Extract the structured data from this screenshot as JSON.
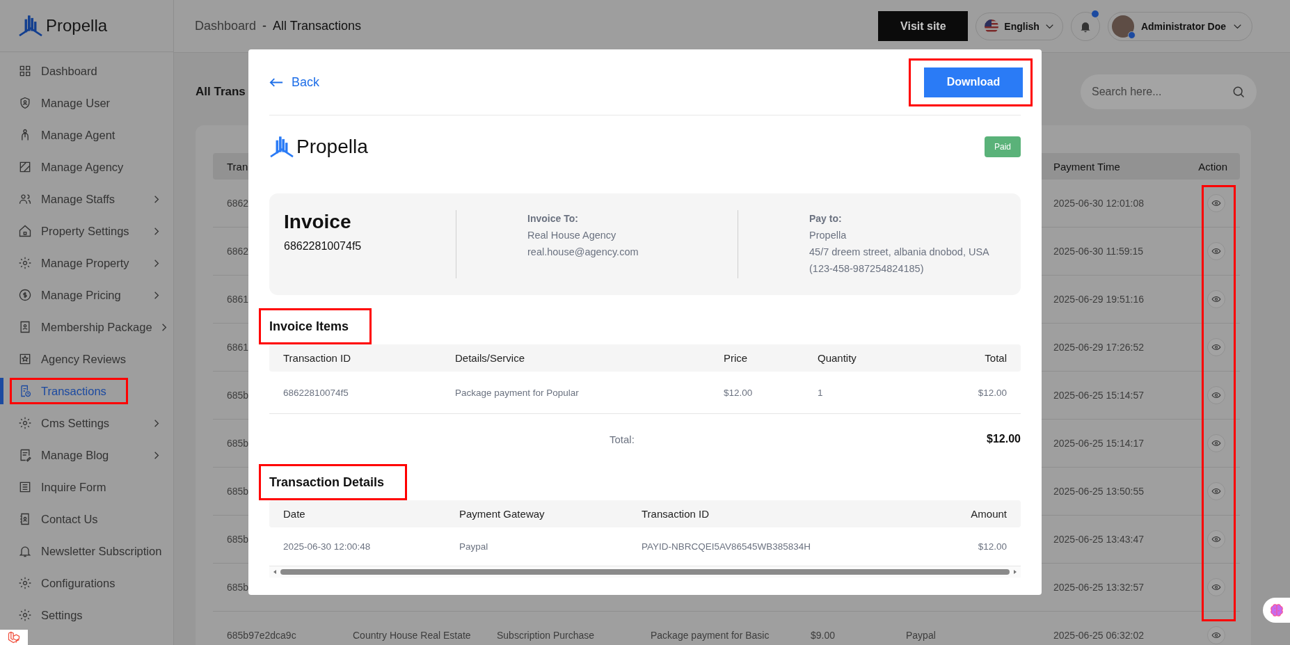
{
  "sidebar": {
    "logo": "Propella",
    "items": [
      {
        "label": "Dashboard",
        "selected": false,
        "expandable": false,
        "highlighted": false
      },
      {
        "label": "Manage User",
        "selected": false,
        "expandable": false,
        "highlighted": false
      },
      {
        "label": "Manage Agent",
        "selected": false,
        "expandable": false,
        "highlighted": false
      },
      {
        "label": "Manage Agency",
        "selected": false,
        "expandable": false,
        "highlighted": false
      },
      {
        "label": "Manage Staffs",
        "selected": false,
        "expandable": true,
        "highlighted": false
      },
      {
        "label": "Property Settings",
        "selected": false,
        "expandable": true,
        "highlighted": false
      },
      {
        "label": "Manage Property",
        "selected": false,
        "expandable": true,
        "highlighted": false
      },
      {
        "label": "Manage Pricing",
        "selected": false,
        "expandable": true,
        "highlighted": false
      },
      {
        "label": "Membership Package",
        "selected": false,
        "expandable": true,
        "highlighted": false
      },
      {
        "label": "Agency Reviews",
        "selected": false,
        "expandable": false,
        "highlighted": false
      },
      {
        "label": "Transactions",
        "selected": true,
        "expandable": false,
        "highlighted": true
      },
      {
        "label": "Cms Settings",
        "selected": false,
        "expandable": true,
        "highlighted": false
      },
      {
        "label": "Manage Blog",
        "selected": false,
        "expandable": true,
        "highlighted": false
      },
      {
        "label": "Inquire Form",
        "selected": false,
        "expandable": false,
        "highlighted": false
      },
      {
        "label": "Contact Us",
        "selected": false,
        "expandable": false,
        "highlighted": false
      },
      {
        "label": "Newsletter Subscription",
        "selected": false,
        "expandable": false,
        "highlighted": false
      },
      {
        "label": "Configurations",
        "selected": false,
        "expandable": false,
        "highlighted": false
      },
      {
        "label": "Settings",
        "selected": false,
        "expandable": false,
        "highlighted": false
      }
    ]
  },
  "header": {
    "breadcrumb": "Dashboard",
    "separator": "-",
    "current": "All Transactions",
    "visit_site": "Visit site",
    "language": "English",
    "notifications_unread": true,
    "user": {
      "name": "Administrator Doe",
      "online": true
    }
  },
  "page": {
    "title": "All Trans",
    "search": {
      "placeholder": "Search here..."
    }
  },
  "table": {
    "columns": {
      "id": "Tran",
      "payment_time": "Payment Time",
      "action": "Action"
    },
    "action_highlighted": true,
    "rows": [
      {
        "id": "6862",
        "payment_time": "2025-06-30 12:01:08"
      },
      {
        "id": "6862",
        "payment_time": "2025-06-30 11:59:15"
      },
      {
        "id": "6861",
        "payment_time": "2025-06-29 19:51:16"
      },
      {
        "id": "6861",
        "payment_time": "2025-06-29 17:26:52"
      },
      {
        "id": "685b",
        "payment_time": "2025-06-25 15:14:57"
      },
      {
        "id": "685b",
        "payment_time": "2025-06-25 15:14:17"
      },
      {
        "id": "685b",
        "payment_time": "2025-06-25 13:50:55"
      },
      {
        "id": "685b",
        "payment_time": "2025-06-25 13:43:47"
      },
      {
        "id": "685b",
        "payment_time": "2025-06-25 13:32:57"
      },
      {
        "id": "685b97e2dca9c",
        "column_2": "Country House Real Estate",
        "column_3": "Subscription Purchase",
        "column_4": "Package payment for Basic",
        "column_5": "$9.00",
        "column_6": "Paypal",
        "payment_time": "2025-06-25 06:32:02"
      }
    ]
  },
  "modal": {
    "back": "Back",
    "download": {
      "label": "Download",
      "highlighted": true
    },
    "logo": "Propella",
    "status": "Paid",
    "invoice": {
      "title": "Invoice",
      "number": "68622810074f5",
      "to": {
        "heading": "Invoice To:",
        "lines": [
          "Real House Agency",
          "real.house@agency.com"
        ]
      },
      "pay_to": {
        "heading": "Pay to:",
        "lines": [
          "Propella",
          "45/7 dreem street, albania dnobod, USA",
          "(123-458-987254824185)"
        ]
      }
    },
    "items": {
      "title": "Invoice Items",
      "highlighted": true,
      "columns": [
        "Transaction ID",
        "Details/Service",
        "Price",
        "Quantity",
        "Total"
      ],
      "rows": [
        [
          "68622810074f5",
          "Package payment for Popular",
          "$12.00",
          "1",
          "$12.00"
        ]
      ],
      "total_label": "Total:",
      "total": "$12.00"
    },
    "transaction": {
      "title": "Transaction Details",
      "highlighted": true,
      "columns": [
        "Date",
        "Payment Gateway",
        "Transaction ID",
        "Amount"
      ],
      "rows": [
        [
          "2025-06-30 12:00:48",
          "Paypal",
          "PAYID-NBRCQEI5AV86545WB385834H",
          "$12.00"
        ]
      ]
    }
  }
}
